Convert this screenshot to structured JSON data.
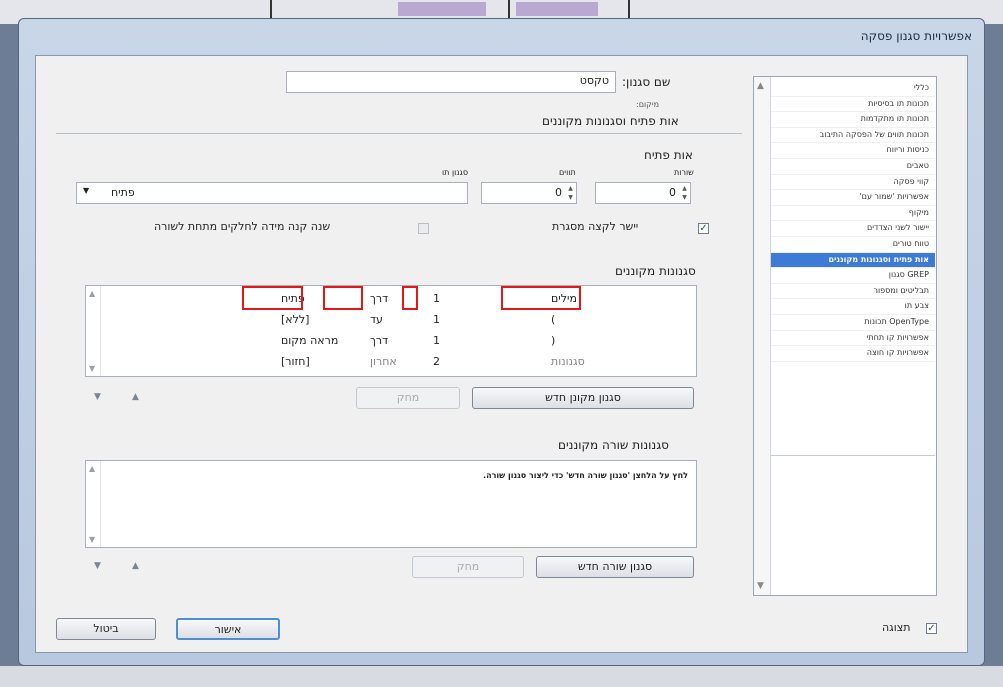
{
  "dialog": {
    "title": "אפשרויות סגנון פסקה"
  },
  "categories": [
    "כללי",
    "תכונות תו בסיסיות",
    "תכונות תו מתקדמות",
    "תכונות תווים של הפסקה התיבוב",
    "כניסות וריווח",
    "טאבים",
    "קווי פסקה",
    "אפשרויות 'שמור עם'",
    "מיקוף",
    "יישור לשני הצדדים",
    "טווח טורים",
    "אות פתיח וסגנונות מקוננים",
    "GREP סגנון",
    "תבליטים ומספור",
    "צבע תו",
    "OpenType תכונות",
    "אפשרויות קו תחתי",
    "אפשרויות קו חוצה"
  ],
  "selected_category_index": 11,
  "style_name": {
    "label": "שם סגנון:",
    "value": "טקסט"
  },
  "location_label": "מיקום:",
  "section_title": "אות פתיח וסגנונות מקוננים",
  "drop_caps": {
    "title": "אות פתיח",
    "lines_label": "שורות",
    "lines_value": "0",
    "chars_label": "תווים",
    "chars_value": "0",
    "char_style_label": "סגנון תו",
    "char_style_value": "פתיח",
    "align_frame_label": "יישר לקצה מסגרת",
    "align_frame_checked": true,
    "scale_label": "שנה קנה מידה לחלקים מתחת לשורה",
    "scale_checked": false
  },
  "nested_styles": {
    "title": "סגנונות מקוננים",
    "rows": [
      {
        "style": "פתיח",
        "mode": "דרך",
        "count": "1",
        "unit": "מילים"
      },
      {
        "style": "[ללא]",
        "mode": "עד",
        "count": "1",
        "unit": ")"
      },
      {
        "style": "מראה מקום",
        "mode": "דרך",
        "count": "1",
        "unit": "("
      },
      {
        "style": "[חזור]",
        "mode": "אחרון",
        "count": "2",
        "unit": "סגנונות"
      }
    ],
    "new_button": "סגנון מקונן חדש",
    "delete_button": "מחק"
  },
  "nested_line_styles": {
    "title": "סגנונות שורה מקוננים",
    "hint": "לחץ על הלחצן 'סגנון שורה חדש' כדי ליצור סגנון שורה.",
    "new_button": "סגנון שורה חדש",
    "delete_button": "מחק"
  },
  "preview": {
    "label": "תצוגה",
    "checked": true
  },
  "buttons": {
    "ok": "אישור",
    "cancel": "ביטול"
  }
}
